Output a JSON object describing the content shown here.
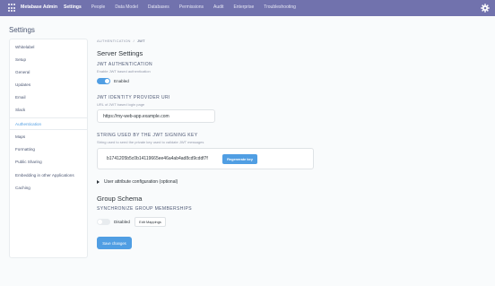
{
  "topnav": {
    "brand": "Metabase Admin",
    "links": [
      "Settings",
      "People",
      "Data Model",
      "Databases",
      "Permissions",
      "Audit",
      "Enterprise",
      "Troubleshooting"
    ],
    "active_index": 0,
    "bg_color": "#7172ad"
  },
  "page_title": "Settings",
  "sidebar": {
    "items": [
      "Whitelabel",
      "Setup",
      "General",
      "Updates",
      "Email",
      "Slack",
      "Authentication",
      "Maps",
      "Formatting",
      "Public Sharing",
      "Embedding in other Applications",
      "Caching"
    ],
    "active_index": 6
  },
  "breadcrumb": {
    "parent": "AUTHENTICATION",
    "separator": "/",
    "current": "JWT"
  },
  "server_settings": {
    "title": "Server Settings",
    "jwt_auth": {
      "label": "JWT AUTHENTICATION",
      "description": "Enable JWT based authentication",
      "toggle_label": "Enabled",
      "enabled": true
    },
    "provider_uri": {
      "label": "JWT IDENTITY PROVIDER URI",
      "description": "URL of JWT based login page",
      "value": "https://my-web-app.example.com"
    },
    "signing_key": {
      "label": "STRING USED BY THE JWT SIGNING KEY",
      "description": "String used to seed the private key used to validate JWT messages",
      "value": "b1741205b5c0b14119665ee46a4ab4ad8cd9cddf7f",
      "button_label": "Regenerate key"
    },
    "user_attr_config": "User attribute configuration (optional)"
  },
  "group_schema": {
    "title": "Group Schema",
    "sync_label": "SYNCHRONIZE GROUP MEMBERSHIPS",
    "toggle_label": "Disabled",
    "enabled": false,
    "edit_mappings_label": "Edit Mappings"
  },
  "save_button": "Save changes",
  "accent_color": "#509ee3"
}
